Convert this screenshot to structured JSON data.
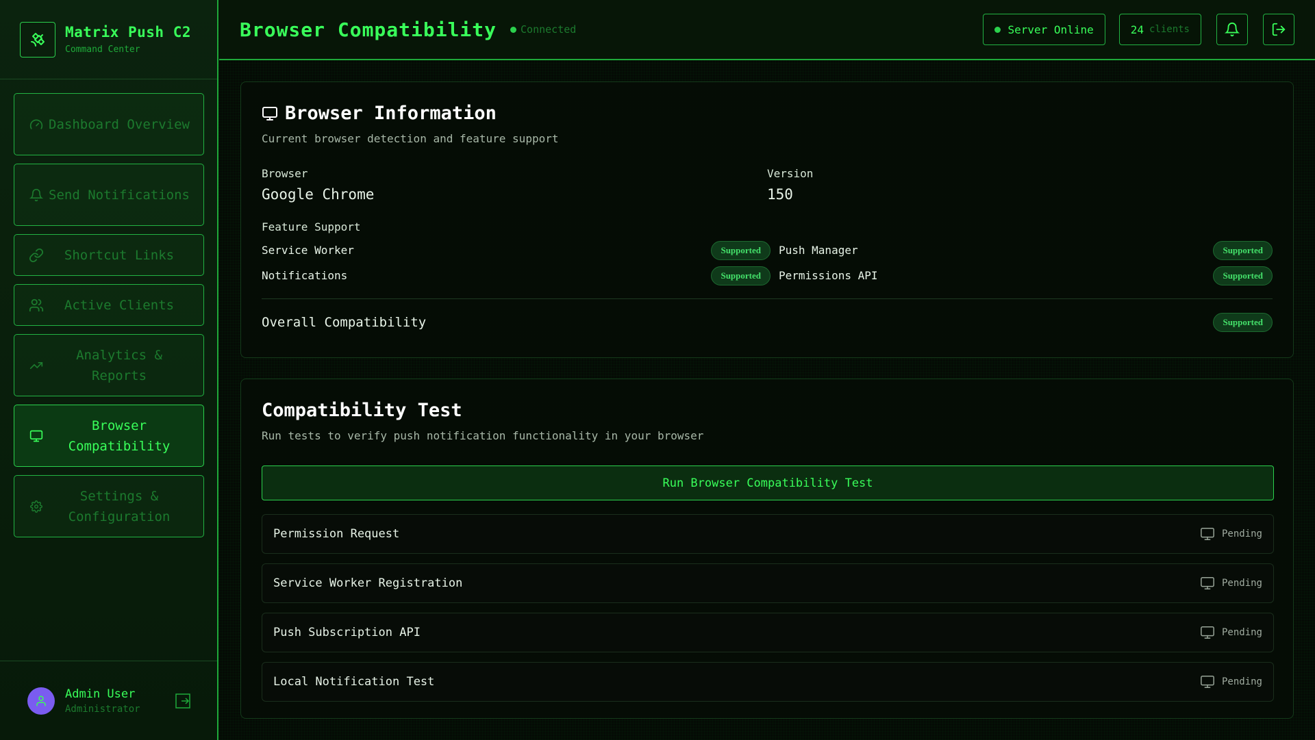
{
  "brand": {
    "title": "Matrix Push C2",
    "subtitle": "Command Center",
    "icon": "satellite-icon"
  },
  "nav": [
    {
      "label": "Dashboard Overview",
      "icon": "gauge-icon",
      "active": false
    },
    {
      "label": "Send Notifications",
      "icon": "bell-icon",
      "active": false
    },
    {
      "label": "Shortcut Links",
      "icon": "link-icon",
      "active": false
    },
    {
      "label": "Active Clients",
      "icon": "users-icon",
      "active": false
    },
    {
      "label": "Analytics & Reports",
      "icon": "trending-up-icon",
      "active": false
    },
    {
      "label": "Browser Compatibility",
      "icon": "monitor-icon",
      "active": true
    },
    {
      "label": "Settings & Configuration",
      "icon": "gear-icon",
      "active": false
    }
  ],
  "user": {
    "name": "Admin User",
    "role": "Administrator"
  },
  "header": {
    "title": "Browser Compatibility",
    "connection": "Connected",
    "server_status": "Server Online",
    "clients_count": "24",
    "clients_label": "clients"
  },
  "browser_info": {
    "title": "Browser Information",
    "subtitle": "Current browser detection and feature support",
    "browser_label": "Browser",
    "browser_value": "Google Chrome",
    "version_label": "Version",
    "version_value": "150",
    "feature_label": "Feature Support",
    "features": [
      {
        "name": "Service Worker",
        "status": "Supported"
      },
      {
        "name": "Push Manager",
        "status": "Supported"
      },
      {
        "name": "Notifications",
        "status": "Supported"
      },
      {
        "name": "Permissions API",
        "status": "Supported"
      }
    ],
    "overall_label": "Overall Compatibility",
    "overall_status": "Supported"
  },
  "compat_test": {
    "title": "Compatibility Test",
    "subtitle": "Run tests to verify push notification functionality in your browser",
    "run_button": "Run Browser Compatibility Test",
    "tests": [
      {
        "name": "Permission Request",
        "status": "Pending"
      },
      {
        "name": "Service Worker Registration",
        "status": "Pending"
      },
      {
        "name": "Push Subscription API",
        "status": "Pending"
      },
      {
        "name": "Local Notification Test",
        "status": "Pending"
      }
    ]
  },
  "colors": {
    "accent": "#39ff5a",
    "border": "#22b343",
    "background": "#050b05",
    "avatar": "#7a5cf0"
  }
}
